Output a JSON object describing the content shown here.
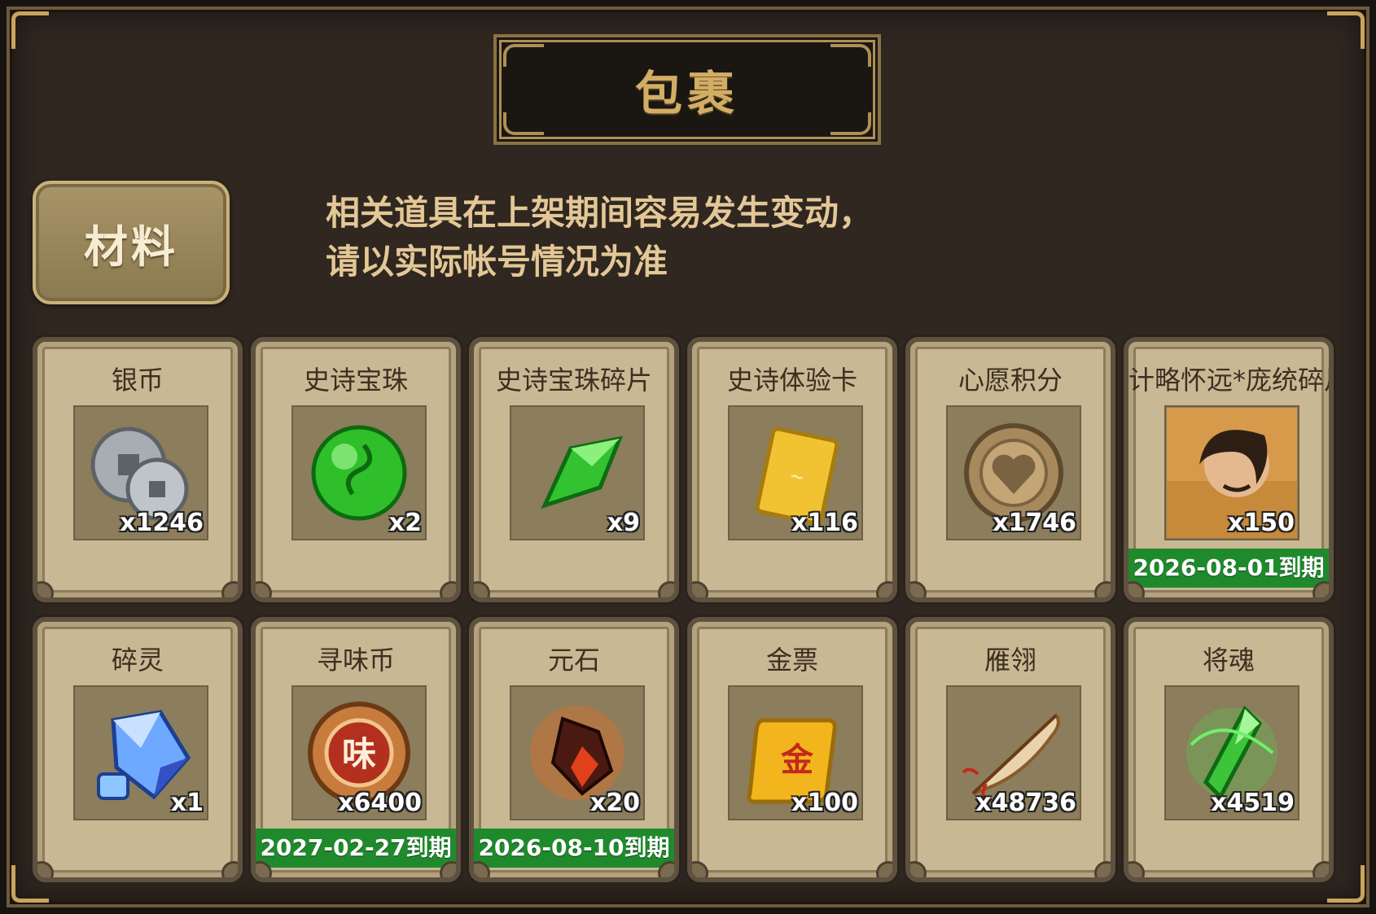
{
  "window": {
    "title": "包裹"
  },
  "tab": {
    "label": "材料"
  },
  "notice": {
    "line1": "相关道具在上架期间容易发生变动，",
    "line2": "请以实际帐号情况为准"
  },
  "items": [
    {
      "name": "银币",
      "quantity": "x1246",
      "icon": "silver-coin-icon",
      "expiry": ""
    },
    {
      "name": "史诗宝珠",
      "quantity": "x2",
      "icon": "green-orb-icon",
      "expiry": ""
    },
    {
      "name": "史诗宝珠碎片",
      "quantity": "x9",
      "icon": "green-shard-icon",
      "expiry": ""
    },
    {
      "name": "史诗体验卡",
      "quantity": "x116",
      "icon": "gold-card-icon",
      "expiry": ""
    },
    {
      "name": "心愿积分",
      "quantity": "x1746",
      "icon": "heart-coin-icon",
      "expiry": ""
    },
    {
      "name": "计略怀远*庞统碎片",
      "quantity": "x150",
      "icon": "hero-portrait-icon",
      "expiry": "2026-08-01到期"
    },
    {
      "name": "碎灵",
      "quantity": "x1",
      "icon": "blue-crystal-icon",
      "expiry": ""
    },
    {
      "name": "寻味币",
      "quantity": "x6400",
      "icon": "taste-coin-icon",
      "expiry": "2027-02-27到期"
    },
    {
      "name": "元石",
      "quantity": "x20",
      "icon": "red-stone-icon",
      "expiry": "2026-08-10到期"
    },
    {
      "name": "金票",
      "quantity": "x100",
      "icon": "gold-scroll-icon",
      "expiry": ""
    },
    {
      "name": "雁翎",
      "quantity": "x48736",
      "icon": "feather-icon",
      "expiry": ""
    },
    {
      "name": "将魂",
      "quantity": "x4519",
      "icon": "green-soul-crystal-icon",
      "expiry": ""
    }
  ],
  "colors": {
    "background": "#2f2720",
    "gold_accent": "#d3ad64",
    "expiry_green": "#1f8a2c",
    "card": "#c9b894"
  }
}
